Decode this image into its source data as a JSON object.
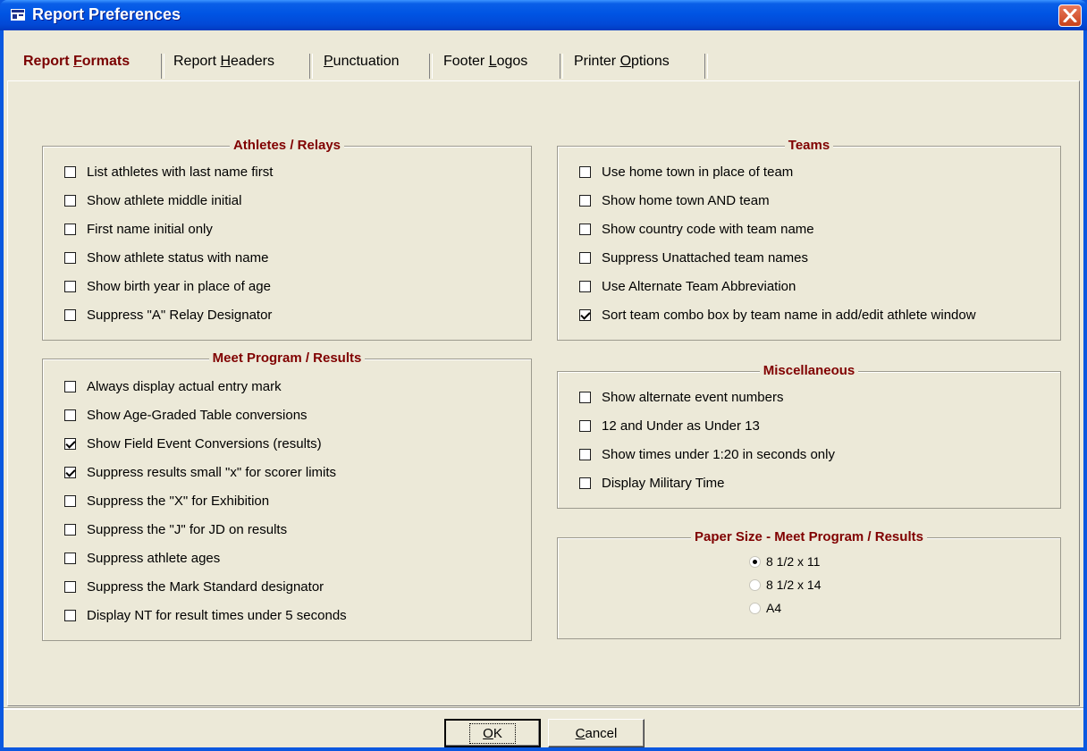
{
  "window": {
    "title": "Report Preferences"
  },
  "tabs": [
    {
      "pre": "Report ",
      "acc": "F",
      "post": "ormats"
    },
    {
      "pre": "Report ",
      "acc": "H",
      "post": "eaders"
    },
    {
      "pre": "",
      "acc": "P",
      "post": "unctuation"
    },
    {
      "pre": "Footer ",
      "acc": "L",
      "post": "ogos"
    },
    {
      "pre": "Printer ",
      "acc": "O",
      "post": "ptions"
    }
  ],
  "athletes_relays": {
    "title": "Athletes / Relays",
    "items": [
      {
        "label": "List athletes with last name first",
        "checked": false
      },
      {
        "label": "Show athlete middle initial",
        "checked": false
      },
      {
        "label": "First name initial only",
        "checked": false
      },
      {
        "label": "Show athlete status with name",
        "checked": false
      },
      {
        "label": "Show birth year in place of age",
        "checked": false
      },
      {
        "label": "Suppress \"A\" Relay Designator",
        "checked": false
      }
    ]
  },
  "meet_program": {
    "title": "Meet Program / Results",
    "items": [
      {
        "label": "Always display actual entry mark",
        "checked": false
      },
      {
        "label": "Show Age-Graded Table conversions",
        "checked": false
      },
      {
        "label": "Show Field Event Conversions (results)",
        "checked": true
      },
      {
        "label": "Suppress results small \"x\" for scorer limits",
        "checked": true
      },
      {
        "label": "Suppress the \"X\" for Exhibition",
        "checked": false
      },
      {
        "label": "Suppress the \"J\" for JD on results",
        "checked": false
      },
      {
        "label": "Suppress athlete ages",
        "checked": false
      },
      {
        "label": "Suppress the Mark Standard designator",
        "checked": false
      },
      {
        "label": "Display NT for result times under 5 seconds",
        "checked": false
      }
    ]
  },
  "teams": {
    "title": "Teams",
    "items": [
      {
        "label": "Use home town in place of team",
        "checked": false
      },
      {
        "label": "Show home town AND team",
        "checked": false
      },
      {
        "label": "Show country code with team name",
        "checked": false
      },
      {
        "label": "Suppress Unattached team names",
        "checked": false
      },
      {
        "label": "Use Alternate Team Abbreviation",
        "checked": false
      },
      {
        "label": "Sort team combo box by team name in add/edit athlete window",
        "checked": true
      }
    ]
  },
  "misc": {
    "title": "Miscellaneous",
    "items": [
      {
        "label": "Show alternate event numbers",
        "checked": false
      },
      {
        "label": "12 and Under as Under 13",
        "checked": false
      },
      {
        "label": "Show times under 1:20 in seconds only",
        "checked": false
      },
      {
        "label": "Display Military Time",
        "checked": false
      }
    ]
  },
  "paper": {
    "title": "Paper Size - Meet Program / Results",
    "options": [
      {
        "label": "8 1/2 x 11",
        "selected": true
      },
      {
        "label": "8 1/2 x 14",
        "selected": false
      },
      {
        "label": "A4",
        "selected": false
      }
    ]
  },
  "buttons": {
    "ok": {
      "acc": "O",
      "post": "K"
    },
    "cancel": {
      "acc": "C",
      "post": "ancel"
    }
  }
}
